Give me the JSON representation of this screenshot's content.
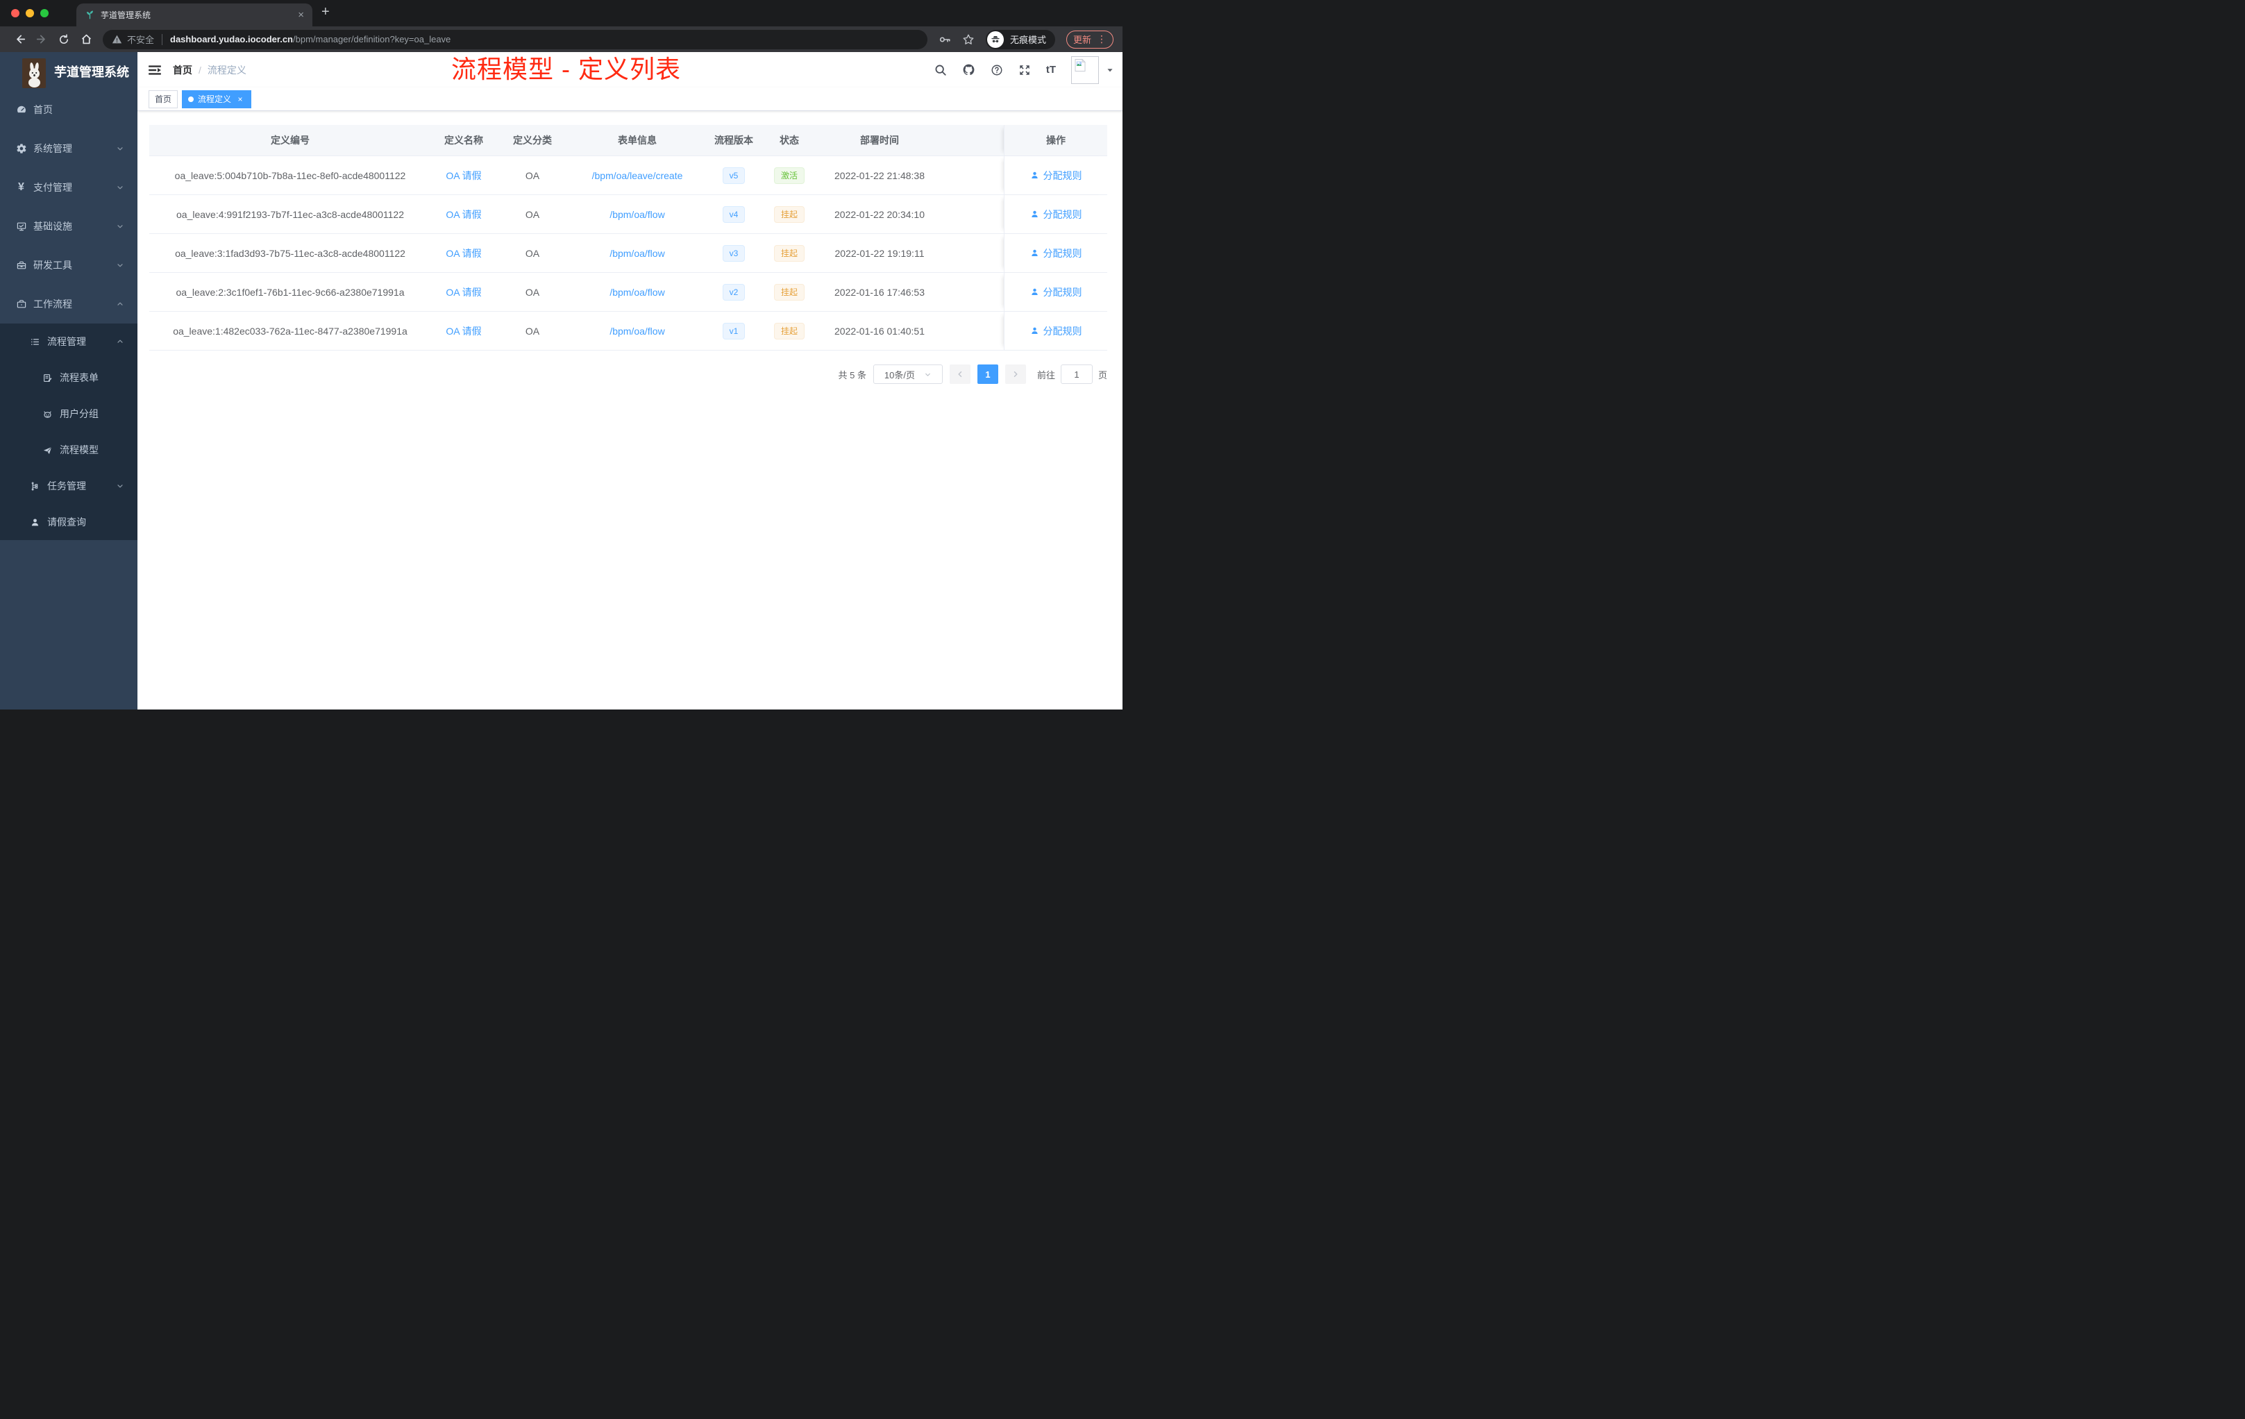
{
  "browser": {
    "tab_title": "芋道管理系统",
    "address": {
      "security_label": "不安全",
      "url_domain": "dashboard.yudao.iocoder.cn",
      "url_path": "/bpm/manager/definition?key=oa_leave"
    },
    "incognito_label": "无痕模式",
    "update_label": "更新"
  },
  "sidebar": {
    "logo_title": "芋道管理系统",
    "menu": [
      {
        "label": "首页"
      },
      {
        "label": "系统管理"
      },
      {
        "label": "支付管理"
      },
      {
        "label": "基础设施"
      },
      {
        "label": "研发工具"
      },
      {
        "label": "工作流程"
      },
      {
        "label": "流程管理"
      },
      {
        "label": "流程表单"
      },
      {
        "label": "用户分组"
      },
      {
        "label": "流程模型"
      },
      {
        "label": "任务管理"
      },
      {
        "label": "请假查询"
      }
    ]
  },
  "header": {
    "breadcrumb_home": "首页",
    "breadcrumb_separator": "/",
    "breadcrumb_current": "流程定义",
    "annotation": "流程模型 - 定义列表"
  },
  "tagbar": {
    "home_tag": "首页",
    "active_tag": "流程定义"
  },
  "table": {
    "columns": [
      "定义编号",
      "定义名称",
      "定义分类",
      "表单信息",
      "流程版本",
      "状态",
      "部署时间",
      "操作"
    ],
    "action_label": "分配规则",
    "rows": [
      {
        "id": "oa_leave:5:004b710b-7b8a-11ec-8ef0-acde48001122",
        "name": "OA 请假",
        "category": "OA",
        "form": "/bpm/oa/leave/create",
        "version": "v5",
        "status": "激活",
        "deploy_time": "2022-01-22 21:48:38"
      },
      {
        "id": "oa_leave:4:991f2193-7b7f-11ec-a3c8-acde48001122",
        "name": "OA 请假",
        "category": "OA",
        "form": "/bpm/oa/flow",
        "version": "v4",
        "status": "挂起",
        "deploy_time": "2022-01-22 20:34:10"
      },
      {
        "id": "oa_leave:3:1fad3d93-7b75-11ec-a3c8-acde48001122",
        "name": "OA 请假",
        "category": "OA",
        "form": "/bpm/oa/flow",
        "version": "v3",
        "status": "挂起",
        "deploy_time": "2022-01-22 19:19:11"
      },
      {
        "id": "oa_leave:2:3c1f0ef1-76b1-11ec-9c66-a2380e71991a",
        "name": "OA 请假",
        "category": "OA",
        "form": "/bpm/oa/flow",
        "version": "v2",
        "status": "挂起",
        "deploy_time": "2022-01-16 17:46:53"
      },
      {
        "id": "oa_leave:1:482ec033-762a-11ec-8477-a2380e71991a",
        "name": "OA 请假",
        "category": "OA",
        "form": "/bpm/oa/flow",
        "version": "v1",
        "status": "挂起",
        "deploy_time": "2022-01-16 01:40:51"
      }
    ]
  },
  "pagination": {
    "total_label": "共 5 条",
    "page_size_label": "10条/页",
    "current_page": "1",
    "goto_label": "前往",
    "goto_value": "1",
    "page_unit": "页"
  },
  "icons": {
    "tab_close": "×",
    "new_tab": "+",
    "tag_close": "×",
    "kebab": "⋮",
    "yen": "¥",
    "help": "?",
    "font_size": "tT"
  },
  "colors": {
    "accent": "#409eff",
    "link": "#409eff",
    "status_active": "#67c23a",
    "status_suspended": "#e6a23c",
    "sidebar_bg": "#304156",
    "sidebar_submenu_bg": "#1f2d3d",
    "annotation_red": "#ff2a12"
  }
}
